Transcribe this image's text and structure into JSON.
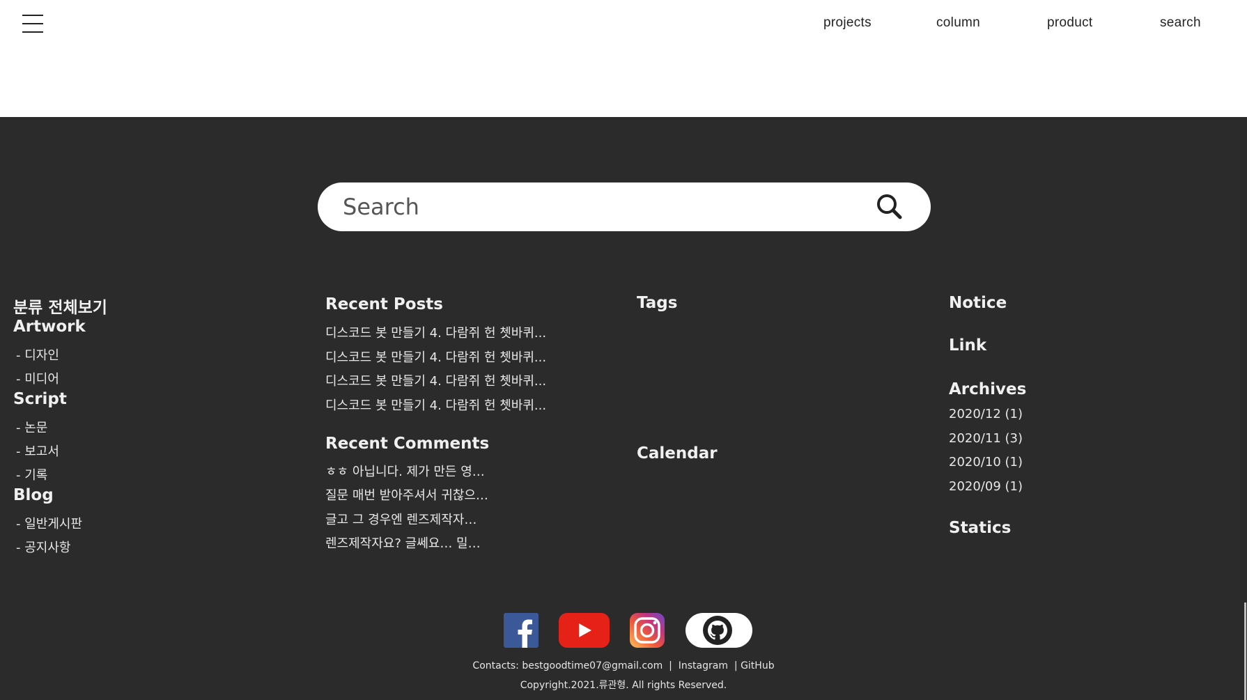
{
  "header": {
    "nav": [
      "projects",
      "column",
      "product",
      "search"
    ]
  },
  "search": {
    "placeholder": "Search"
  },
  "categories": {
    "title": "분류 전체보기",
    "groups": [
      {
        "label": "Artwork",
        "items": [
          "- 디자인",
          "- 미디어"
        ]
      },
      {
        "label": "Script",
        "items": [
          "- 논문",
          "- 보고서",
          "- 기록"
        ]
      },
      {
        "label": "Blog",
        "items": [
          "- 일반게시판",
          "- 공지사항"
        ]
      }
    ]
  },
  "recent_posts": {
    "title": "Recent Posts",
    "items": [
      "디스코드 봇 만들기 4. 다람쥐 헌 쳇바퀴...",
      "디스코드 봇 만들기 4. 다람쥐 헌 쳇바퀴...",
      "디스코드 봇 만들기 4. 다람쥐 헌 쳇바퀴...",
      "디스코드 봇 만들기 4. 다람쥐 헌 쳇바퀴..."
    ]
  },
  "recent_comments": {
    "title": "Recent Comments",
    "items": [
      "ㅎㅎ 아닙니다. 제가 만든 영…",
      "질문 매번 받아주셔서 귀찮으…",
      "글고 그 경우엔 렌즈제작자…",
      "렌즈제작자요? 글쎄요… 밀…"
    ]
  },
  "tags": {
    "title": "Tags"
  },
  "calendar": {
    "title": "Calendar"
  },
  "notice": {
    "title": "Notice"
  },
  "link": {
    "title": "Link"
  },
  "archives": {
    "title": "Archives",
    "items": [
      "2020/12 (1)",
      "2020/11 (3)",
      "2020/10 (1)",
      "2020/09 (1)"
    ]
  },
  "statics": {
    "title": "Statics"
  },
  "social": {
    "icons": [
      "facebook-icon",
      "youtube-icon",
      "instagram-icon",
      "github-icon"
    ],
    "colors": {
      "facebook": "#3b5998",
      "youtube": "#e62117",
      "github_bg": "#ffffff"
    }
  },
  "footer": {
    "contacts_label": "Contacts: bestgoodtime07@gmail.com",
    "separator": "|",
    "instagram": "Instagram",
    "github": "GitHub",
    "copyright": "Copyright.2021.류관형. All rights Reserved."
  },
  "colors": {
    "background_dark": "#2b2b2c",
    "header_bg": "#ffffff",
    "text_light": "#f0f0f0"
  }
}
